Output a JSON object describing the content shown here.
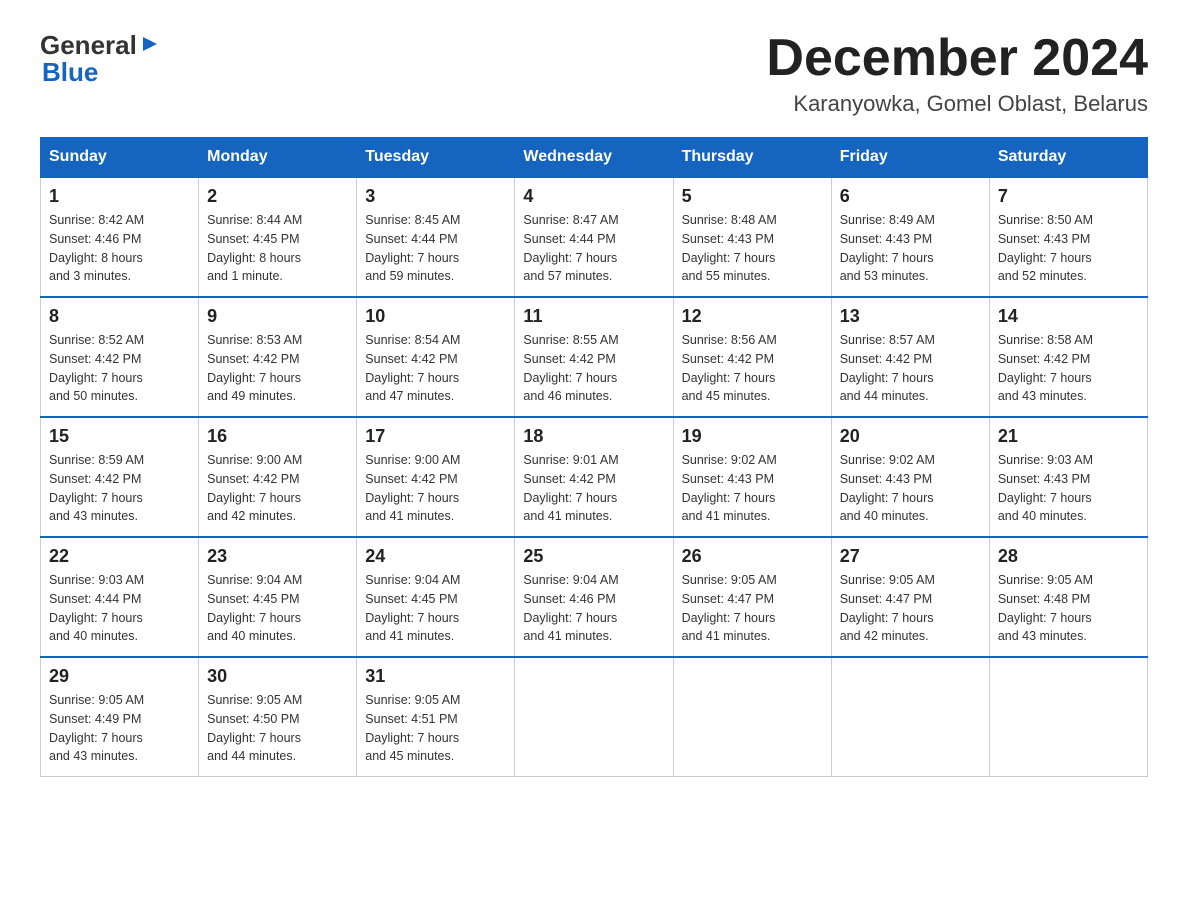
{
  "header": {
    "logo_general": "General",
    "logo_blue": "Blue",
    "month_title": "December 2024",
    "location": "Karanyowka, Gomel Oblast, Belarus"
  },
  "weekdays": [
    "Sunday",
    "Monday",
    "Tuesday",
    "Wednesday",
    "Thursday",
    "Friday",
    "Saturday"
  ],
  "weeks": [
    [
      {
        "day": "1",
        "sunrise": "8:42 AM",
        "sunset": "4:46 PM",
        "daylight": "8 hours and 3 minutes."
      },
      {
        "day": "2",
        "sunrise": "8:44 AM",
        "sunset": "4:45 PM",
        "daylight": "8 hours and 1 minute."
      },
      {
        "day": "3",
        "sunrise": "8:45 AM",
        "sunset": "4:44 PM",
        "daylight": "7 hours and 59 minutes."
      },
      {
        "day": "4",
        "sunrise": "8:47 AM",
        "sunset": "4:44 PM",
        "daylight": "7 hours and 57 minutes."
      },
      {
        "day": "5",
        "sunrise": "8:48 AM",
        "sunset": "4:43 PM",
        "daylight": "7 hours and 55 minutes."
      },
      {
        "day": "6",
        "sunrise": "8:49 AM",
        "sunset": "4:43 PM",
        "daylight": "7 hours and 53 minutes."
      },
      {
        "day": "7",
        "sunrise": "8:50 AM",
        "sunset": "4:43 PM",
        "daylight": "7 hours and 52 minutes."
      }
    ],
    [
      {
        "day": "8",
        "sunrise": "8:52 AM",
        "sunset": "4:42 PM",
        "daylight": "7 hours and 50 minutes."
      },
      {
        "day": "9",
        "sunrise": "8:53 AM",
        "sunset": "4:42 PM",
        "daylight": "7 hours and 49 minutes."
      },
      {
        "day": "10",
        "sunrise": "8:54 AM",
        "sunset": "4:42 PM",
        "daylight": "7 hours and 47 minutes."
      },
      {
        "day": "11",
        "sunrise": "8:55 AM",
        "sunset": "4:42 PM",
        "daylight": "7 hours and 46 minutes."
      },
      {
        "day": "12",
        "sunrise": "8:56 AM",
        "sunset": "4:42 PM",
        "daylight": "7 hours and 45 minutes."
      },
      {
        "day": "13",
        "sunrise": "8:57 AM",
        "sunset": "4:42 PM",
        "daylight": "7 hours and 44 minutes."
      },
      {
        "day": "14",
        "sunrise": "8:58 AM",
        "sunset": "4:42 PM",
        "daylight": "7 hours and 43 minutes."
      }
    ],
    [
      {
        "day": "15",
        "sunrise": "8:59 AM",
        "sunset": "4:42 PM",
        "daylight": "7 hours and 43 minutes."
      },
      {
        "day": "16",
        "sunrise": "9:00 AM",
        "sunset": "4:42 PM",
        "daylight": "7 hours and 42 minutes."
      },
      {
        "day": "17",
        "sunrise": "9:00 AM",
        "sunset": "4:42 PM",
        "daylight": "7 hours and 41 minutes."
      },
      {
        "day": "18",
        "sunrise": "9:01 AM",
        "sunset": "4:42 PM",
        "daylight": "7 hours and 41 minutes."
      },
      {
        "day": "19",
        "sunrise": "9:02 AM",
        "sunset": "4:43 PM",
        "daylight": "7 hours and 41 minutes."
      },
      {
        "day": "20",
        "sunrise": "9:02 AM",
        "sunset": "4:43 PM",
        "daylight": "7 hours and 40 minutes."
      },
      {
        "day": "21",
        "sunrise": "9:03 AM",
        "sunset": "4:43 PM",
        "daylight": "7 hours and 40 minutes."
      }
    ],
    [
      {
        "day": "22",
        "sunrise": "9:03 AM",
        "sunset": "4:44 PM",
        "daylight": "7 hours and 40 minutes."
      },
      {
        "day": "23",
        "sunrise": "9:04 AM",
        "sunset": "4:45 PM",
        "daylight": "7 hours and 40 minutes."
      },
      {
        "day": "24",
        "sunrise": "9:04 AM",
        "sunset": "4:45 PM",
        "daylight": "7 hours and 41 minutes."
      },
      {
        "day": "25",
        "sunrise": "9:04 AM",
        "sunset": "4:46 PM",
        "daylight": "7 hours and 41 minutes."
      },
      {
        "day": "26",
        "sunrise": "9:05 AM",
        "sunset": "4:47 PM",
        "daylight": "7 hours and 41 minutes."
      },
      {
        "day": "27",
        "sunrise": "9:05 AM",
        "sunset": "4:47 PM",
        "daylight": "7 hours and 42 minutes."
      },
      {
        "day": "28",
        "sunrise": "9:05 AM",
        "sunset": "4:48 PM",
        "daylight": "7 hours and 43 minutes."
      }
    ],
    [
      {
        "day": "29",
        "sunrise": "9:05 AM",
        "sunset": "4:49 PM",
        "daylight": "7 hours and 43 minutes."
      },
      {
        "day": "30",
        "sunrise": "9:05 AM",
        "sunset": "4:50 PM",
        "daylight": "7 hours and 44 minutes."
      },
      {
        "day": "31",
        "sunrise": "9:05 AM",
        "sunset": "4:51 PM",
        "daylight": "7 hours and 45 minutes."
      },
      null,
      null,
      null,
      null
    ]
  ]
}
